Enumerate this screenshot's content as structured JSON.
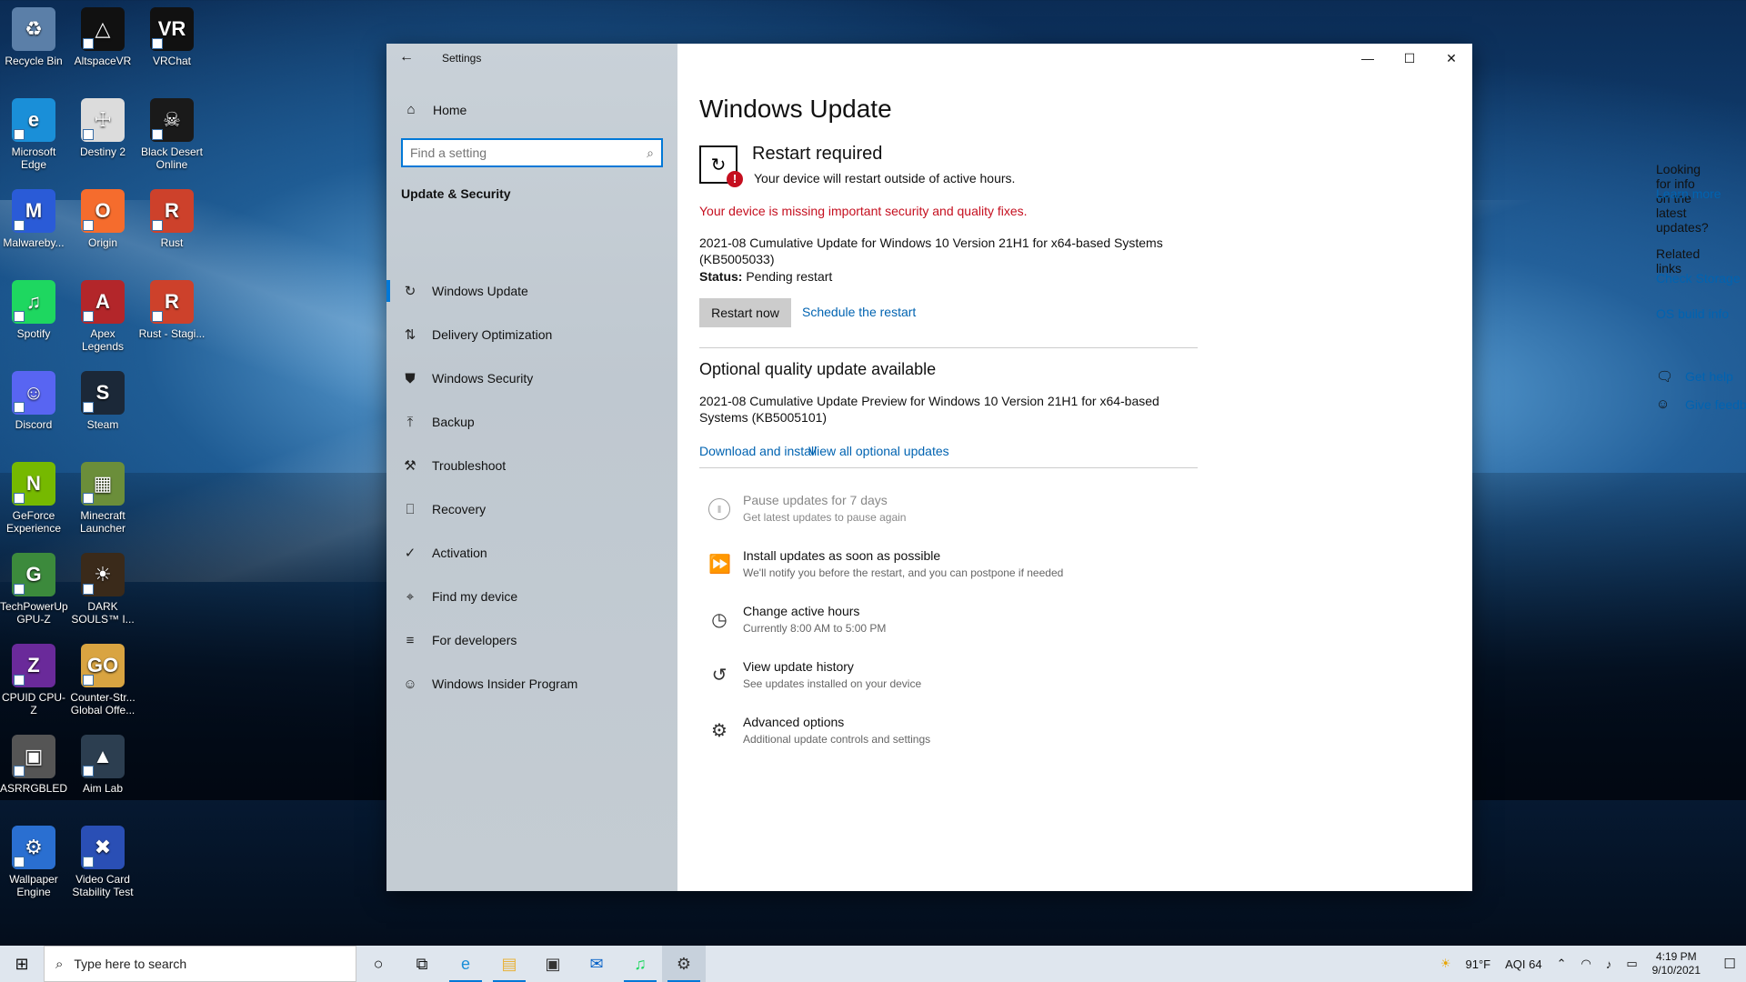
{
  "desktop": {
    "icons": [
      {
        "label": "Recycle Bin",
        "glyph": "♻",
        "color": "#5b7fa8"
      },
      {
        "label": "AltspaceVR",
        "glyph": "△",
        "color": "#111111"
      },
      {
        "label": "VRChat",
        "glyph": "VR",
        "color": "#111111"
      },
      {
        "label": "Microsoft Edge",
        "glyph": "e",
        "color": "#1a8fd8"
      },
      {
        "label": "Destiny 2",
        "glyph": "☩",
        "color": "#dcdcdc"
      },
      {
        "label": "Black Desert Online",
        "glyph": "☠",
        "color": "#1a1a1a"
      },
      {
        "label": "Malwareby...",
        "glyph": "M",
        "color": "#2a5bd7"
      },
      {
        "label": "Origin",
        "glyph": "O",
        "color": "#f56c2d"
      },
      {
        "label": "Rust",
        "glyph": "R",
        "color": "#cd412b"
      },
      {
        "label": "Spotify",
        "glyph": "♫",
        "color": "#1ed760"
      },
      {
        "label": "Apex Legends",
        "glyph": "A",
        "color": "#b3262a"
      },
      {
        "label": "Rust - Stagi...",
        "glyph": "R",
        "color": "#cd412b"
      },
      {
        "label": "Discord",
        "glyph": "☺",
        "color": "#5865f2"
      },
      {
        "label": "Steam",
        "glyph": "S",
        "color": "#1b2838"
      },
      {
        "label": "GeForce Experience",
        "glyph": "N",
        "color": "#76b900"
      },
      {
        "label": "Minecraft Launcher",
        "glyph": "▦",
        "color": "#6b8e3a"
      },
      {
        "label": "TechPowerUp GPU-Z",
        "glyph": "G",
        "color": "#3c8a3c"
      },
      {
        "label": "DARK SOULS™ I...",
        "glyph": "☀",
        "color": "#3a2a1a"
      },
      {
        "label": "CPUID CPU-Z",
        "glyph": "Z",
        "color": "#6a2a9a"
      },
      {
        "label": "Counter-Str... Global Offe...",
        "glyph": "GO",
        "color": "#d9a441"
      },
      {
        "label": "ASRRGBLED",
        "glyph": "▣",
        "color": "#555555"
      },
      {
        "label": "Aim Lab",
        "glyph": "▲",
        "color": "#2c3e50"
      },
      {
        "label": "Wallpaper Engine",
        "glyph": "⚙",
        "color": "#2a6fd1"
      },
      {
        "label": "Video Card Stability Test",
        "glyph": "✖",
        "color": "#2a4fb5"
      }
    ]
  },
  "window": {
    "title": "Settings",
    "minimize": "—",
    "maximize": "☐",
    "close": "✕"
  },
  "nav": {
    "back_icon": "←",
    "home_label": "Home",
    "home_icon": "⌂",
    "search_placeholder": "Find a setting",
    "search_icon": "⌕",
    "section_title": "Update & Security",
    "items": [
      {
        "label": "Windows Update",
        "icon": "↻",
        "active": true
      },
      {
        "label": "Delivery Optimization",
        "icon": "⇅",
        "active": false
      },
      {
        "label": "Windows Security",
        "icon": "⛊",
        "active": false
      },
      {
        "label": "Backup",
        "icon": "⤒",
        "active": false
      },
      {
        "label": "Troubleshoot",
        "icon": "⚒",
        "active": false
      },
      {
        "label": "Recovery",
        "icon": "⎕",
        "active": false
      },
      {
        "label": "Activation",
        "icon": "✓",
        "active": false
      },
      {
        "label": "Find my device",
        "icon": "⌖",
        "active": false
      },
      {
        "label": "For developers",
        "icon": "≡",
        "active": false
      },
      {
        "label": "Windows Insider Program",
        "icon": "☺",
        "active": false
      }
    ]
  },
  "main": {
    "page_title": "Windows Update",
    "restart_title": "Restart required",
    "restart_sub": "Your device will restart outside of active hours.",
    "missing_warning": "Your device is missing important security and quality fixes.",
    "update_name": "2021-08 Cumulative Update for Windows 10 Version 21H1 for x64-based Systems (KB5005033)",
    "status_label": "Status:",
    "status_value": "Pending restart",
    "restart_now": "Restart now",
    "schedule_restart": "Schedule the restart",
    "optional_title": "Optional quality update available",
    "optional_name": "2021-08 Cumulative Update Preview for Windows 10 Version 21H1 for x64-based Systems (KB5005101)",
    "download_install": "Download and install",
    "view_optional": "View all optional updates",
    "options": [
      {
        "title": "Pause updates for 7 days",
        "sub": "Get latest updates to pause again",
        "icon": "‖"
      },
      {
        "title": "Install updates as soon as possible",
        "sub": "We'll notify you before the restart, and you can postpone if needed",
        "icon": "⏩"
      },
      {
        "title": "Change active hours",
        "sub": "Currently 8:00 AM to 5:00 PM",
        "icon": "◷"
      },
      {
        "title": "View update history",
        "sub": "See updates installed on your device",
        "icon": "↺"
      },
      {
        "title": "Advanced options",
        "sub": "Additional update controls and settings",
        "icon": "⚙"
      }
    ]
  },
  "side": {
    "question": "Looking for info on the latest updates?",
    "learn_more": "Learn more",
    "related_title": "Related links",
    "check_storage": "Check Storage",
    "os_build": "OS build info",
    "get_help": "Get help",
    "give_feedback": "Give feedback"
  },
  "taskbar": {
    "start_icon": "⊞",
    "search_placeholder": "Type here to search",
    "search_icon": "⌕",
    "apps": [
      {
        "name": "cortana",
        "glyph": "○",
        "running": false,
        "active": false
      },
      {
        "name": "task-view",
        "glyph": "⧉",
        "running": false,
        "active": false
      },
      {
        "name": "edge",
        "glyph": "e",
        "running": true,
        "active": false
      },
      {
        "name": "file-explorer",
        "glyph": "▤",
        "running": true,
        "active": false
      },
      {
        "name": "store",
        "glyph": "▣",
        "running": false,
        "active": false
      },
      {
        "name": "mail",
        "glyph": "✉",
        "running": false,
        "active": false
      },
      {
        "name": "spotify",
        "glyph": "♫",
        "running": true,
        "active": false
      },
      {
        "name": "settings",
        "glyph": "⚙",
        "running": true,
        "active": true
      }
    ],
    "weather_icon": "☀",
    "temperature": "91°F",
    "aqi": "AQI 64",
    "time": "4:19 PM",
    "date": "9/10/2021",
    "tray_up": "⌃",
    "wifi": "◠",
    "volume": "♪",
    "battery": "▭",
    "notification": "☐"
  }
}
